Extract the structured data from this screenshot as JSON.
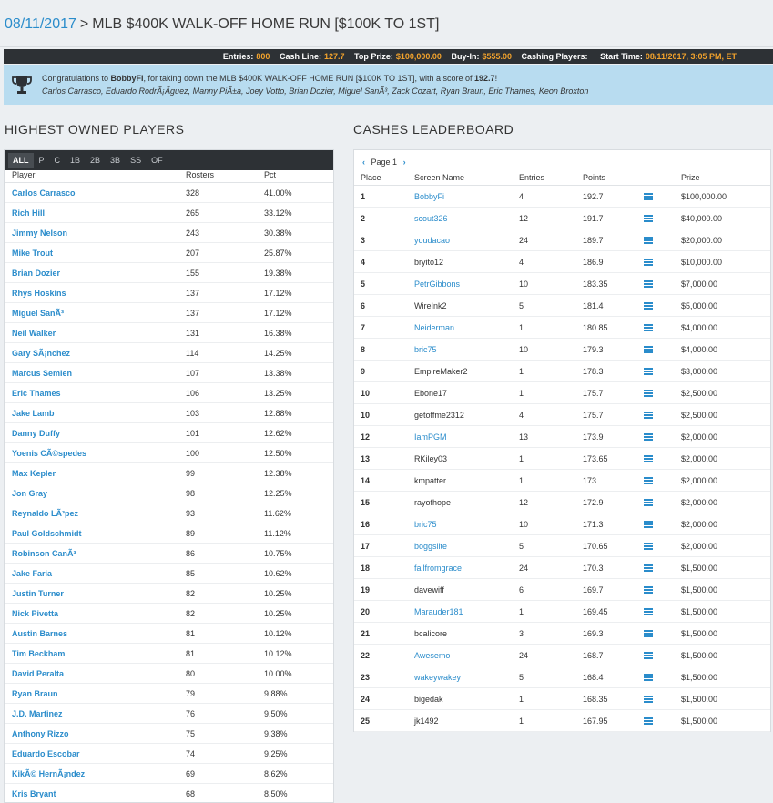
{
  "header": {
    "date": "08/11/2017",
    "separator": ">",
    "contest_name": "MLB $400K WALK-OFF HOME RUN [$100K TO 1ST]"
  },
  "info": {
    "entries_label": "Entries:",
    "entries": "800",
    "cashline_label": "Cash Line:",
    "cashline": "127.7",
    "topprize_label": "Top Prize:",
    "topprize": "$100,000.00",
    "buyin_label": "Buy-In:",
    "buyin": "$555.00",
    "cashing_label": "Cashing Players:",
    "cashing": "",
    "start_label": "Start Time:",
    "start": "08/11/2017, 3:05 PM, ET"
  },
  "congrats": {
    "prefix": "Congratulations to ",
    "winner": "BobbyFi",
    "middle": ", for taking down the MLB $400K WALK-OFF HOME RUN [$100K TO 1ST], with a score of ",
    "score": "192.7",
    "suffix": "!",
    "lineup": "Carlos Carrasco, Eduardo RodrÃ¡Ã­guez, Manny PiÃ±a, Joey Votto, Brian Dozier, Miguel SanÃ³, Zack Cozart, Ryan Braun, Eric Thames, Keon Broxton"
  },
  "sections": {
    "owned_title": "HIGHEST OWNED PLAYERS",
    "cashes_title": "CASHES LEADERBOARD"
  },
  "position_tabs": [
    "ALL",
    "P",
    "C",
    "1B",
    "2B",
    "3B",
    "SS",
    "OF"
  ],
  "owned": {
    "headers": {
      "player": "Player",
      "rosters": "Rosters",
      "pct": "Pct"
    },
    "rows": [
      {
        "player": "Carlos Carrasco",
        "rosters": "328",
        "pct": "41.00%"
      },
      {
        "player": "Rich Hill",
        "rosters": "265",
        "pct": "33.12%"
      },
      {
        "player": "Jimmy Nelson",
        "rosters": "243",
        "pct": "30.38%"
      },
      {
        "player": "Mike Trout",
        "rosters": "207",
        "pct": "25.87%"
      },
      {
        "player": "Brian Dozier",
        "rosters": "155",
        "pct": "19.38%"
      },
      {
        "player": "Rhys Hoskins",
        "rosters": "137",
        "pct": "17.12%"
      },
      {
        "player": "Miguel SanÃ³",
        "rosters": "137",
        "pct": "17.12%"
      },
      {
        "player": "Neil Walker",
        "rosters": "131",
        "pct": "16.38%"
      },
      {
        "player": "Gary SÃ¡nchez",
        "rosters": "114",
        "pct": "14.25%"
      },
      {
        "player": "Marcus Semien",
        "rosters": "107",
        "pct": "13.38%"
      },
      {
        "player": "Eric Thames",
        "rosters": "106",
        "pct": "13.25%"
      },
      {
        "player": "Jake Lamb",
        "rosters": "103",
        "pct": "12.88%"
      },
      {
        "player": "Danny Duffy",
        "rosters": "101",
        "pct": "12.62%"
      },
      {
        "player": "Yoenis CÃ©spedes",
        "rosters": "100",
        "pct": "12.50%"
      },
      {
        "player": "Max Kepler",
        "rosters": "99",
        "pct": "12.38%"
      },
      {
        "player": "Jon Gray",
        "rosters": "98",
        "pct": "12.25%"
      },
      {
        "player": "Reynaldo LÃ³pez",
        "rosters": "93",
        "pct": "11.62%"
      },
      {
        "player": "Paul Goldschmidt",
        "rosters": "89",
        "pct": "11.12%"
      },
      {
        "player": "Robinson CanÃ³",
        "rosters": "86",
        "pct": "10.75%"
      },
      {
        "player": "Jake Faria",
        "rosters": "85",
        "pct": "10.62%"
      },
      {
        "player": "Justin Turner",
        "rosters": "82",
        "pct": "10.25%"
      },
      {
        "player": "Nick Pivetta",
        "rosters": "82",
        "pct": "10.25%"
      },
      {
        "player": "Austin Barnes",
        "rosters": "81",
        "pct": "10.12%"
      },
      {
        "player": "Tim Beckham",
        "rosters": "81",
        "pct": "10.12%"
      },
      {
        "player": "David Peralta",
        "rosters": "80",
        "pct": "10.00%"
      },
      {
        "player": "Ryan Braun",
        "rosters": "79",
        "pct": "9.88%"
      },
      {
        "player": "J.D. Martinez",
        "rosters": "76",
        "pct": "9.50%"
      },
      {
        "player": "Anthony Rizzo",
        "rosters": "75",
        "pct": "9.38%"
      },
      {
        "player": "Eduardo Escobar",
        "rosters": "74",
        "pct": "9.25%"
      },
      {
        "player": "KikÃ© HernÃ¡ndez",
        "rosters": "69",
        "pct": "8.62%"
      },
      {
        "player": "Kris Bryant",
        "rosters": "68",
        "pct": "8.50%"
      }
    ]
  },
  "pager": {
    "label": "Page 1",
    "prev": "‹",
    "next": "›"
  },
  "cashes": {
    "headers": {
      "place": "Place",
      "name": "Screen Name",
      "entries": "Entries",
      "points": "Points",
      "prize": "Prize"
    },
    "rows": [
      {
        "place": "1",
        "name": "BobbyFi",
        "link": true,
        "entries": "4",
        "points": "192.7",
        "prize": "$100,000.00"
      },
      {
        "place": "2",
        "name": "scout326",
        "link": true,
        "entries": "12",
        "points": "191.7",
        "prize": "$40,000.00"
      },
      {
        "place": "3",
        "name": "youdacao",
        "link": true,
        "entries": "24",
        "points": "189.7",
        "prize": "$20,000.00"
      },
      {
        "place": "4",
        "name": "bryito12",
        "link": false,
        "entries": "4",
        "points": "186.9",
        "prize": "$10,000.00"
      },
      {
        "place": "5",
        "name": "PetrGibbons",
        "link": true,
        "entries": "10",
        "points": "183.35",
        "prize": "$7,000.00"
      },
      {
        "place": "6",
        "name": "WireInk2",
        "link": false,
        "entries": "5",
        "points": "181.4",
        "prize": "$5,000.00"
      },
      {
        "place": "7",
        "name": "Neiderman",
        "link": true,
        "entries": "1",
        "points": "180.85",
        "prize": "$4,000.00"
      },
      {
        "place": "8",
        "name": "bric75",
        "link": true,
        "entries": "10",
        "points": "179.3",
        "prize": "$4,000.00"
      },
      {
        "place": "9",
        "name": "EmpireMaker2",
        "link": false,
        "entries": "1",
        "points": "178.3",
        "prize": "$3,000.00"
      },
      {
        "place": "10",
        "name": "Ebone17",
        "link": false,
        "entries": "1",
        "points": "175.7",
        "prize": "$2,500.00"
      },
      {
        "place": "10",
        "name": "getoffme2312",
        "link": false,
        "entries": "4",
        "points": "175.7",
        "prize": "$2,500.00"
      },
      {
        "place": "12",
        "name": "IamPGM",
        "link": true,
        "entries": "13",
        "points": "173.9",
        "prize": "$2,000.00"
      },
      {
        "place": "13",
        "name": "RKiley03",
        "link": false,
        "entries": "1",
        "points": "173.65",
        "prize": "$2,000.00"
      },
      {
        "place": "14",
        "name": "kmpatter",
        "link": false,
        "entries": "1",
        "points": "173",
        "prize": "$2,000.00"
      },
      {
        "place": "15",
        "name": "rayofhope",
        "link": false,
        "entries": "12",
        "points": "172.9",
        "prize": "$2,000.00"
      },
      {
        "place": "16",
        "name": "bric75",
        "link": true,
        "entries": "10",
        "points": "171.3",
        "prize": "$2,000.00"
      },
      {
        "place": "17",
        "name": "boggslite",
        "link": true,
        "entries": "5",
        "points": "170.65",
        "prize": "$2,000.00"
      },
      {
        "place": "18",
        "name": "fallfromgrace",
        "link": true,
        "entries": "24",
        "points": "170.3",
        "prize": "$1,500.00"
      },
      {
        "place": "19",
        "name": "davewiff",
        "link": false,
        "entries": "6",
        "points": "169.7",
        "prize": "$1,500.00"
      },
      {
        "place": "20",
        "name": "Marauder181",
        "link": true,
        "entries": "1",
        "points": "169.45",
        "prize": "$1,500.00"
      },
      {
        "place": "21",
        "name": "bcalicore",
        "link": false,
        "entries": "3",
        "points": "169.3",
        "prize": "$1,500.00"
      },
      {
        "place": "22",
        "name": "Awesemo",
        "link": true,
        "entries": "24",
        "points": "168.7",
        "prize": "$1,500.00"
      },
      {
        "place": "23",
        "name": "wakeywakey",
        "link": true,
        "entries": "5",
        "points": "168.4",
        "prize": "$1,500.00"
      },
      {
        "place": "24",
        "name": "bigedak",
        "link": false,
        "entries": "1",
        "points": "168.35",
        "prize": "$1,500.00"
      },
      {
        "place": "25",
        "name": "jk1492",
        "link": false,
        "entries": "1",
        "points": "167.95",
        "prize": "$1,500.00"
      }
    ]
  },
  "icons": {
    "trophy": "trophy-icon",
    "lineup": "list-icon"
  },
  "colors": {
    "link": "#2a8ccb",
    "accent": "#f3a32c",
    "dark_bar": "#2d3135",
    "banner": "#b8dcf0"
  }
}
